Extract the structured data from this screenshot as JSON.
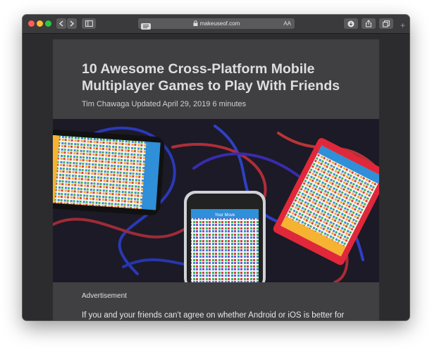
{
  "browser": {
    "address_bar": {
      "url_text": "makeuseof.com",
      "text_size_label": "AA",
      "icons": [
        "reader-view-icon",
        "lock-icon"
      ]
    },
    "toolbar_icons": [
      "back-arrow-icon",
      "forward-arrow-icon",
      "sidebar-icon",
      "downloads-icon",
      "share-icon",
      "tabs-overview-icon"
    ],
    "new_tab_label": "+",
    "window_controls": {
      "close_color": "#fe5f57",
      "minimize_color": "#febc2e",
      "zoom_color": "#28c840"
    }
  },
  "article": {
    "title": "10 Awesome Cross-Platform Mobile Multiplayer Games to Play With Friends",
    "byline": "Tim Chawaga Updated April 29, 2019 6 minutes",
    "hero_image": {
      "phone_screen_labels": [
        "Your Move",
        "Your Move",
        "Your Move"
      ]
    },
    "ad_label": "Advertisement",
    "first_paragraph": "If you and your friends can't agree on whether Android or iOS is better for"
  },
  "colors": {
    "window_background": "#2c2c2e",
    "article_card": "#404042",
    "toolbar": "#3a3a3c",
    "title_text": "#dedede",
    "phone_frame_red": "#e0283a",
    "game_header_blue": "#2f8fd8"
  }
}
